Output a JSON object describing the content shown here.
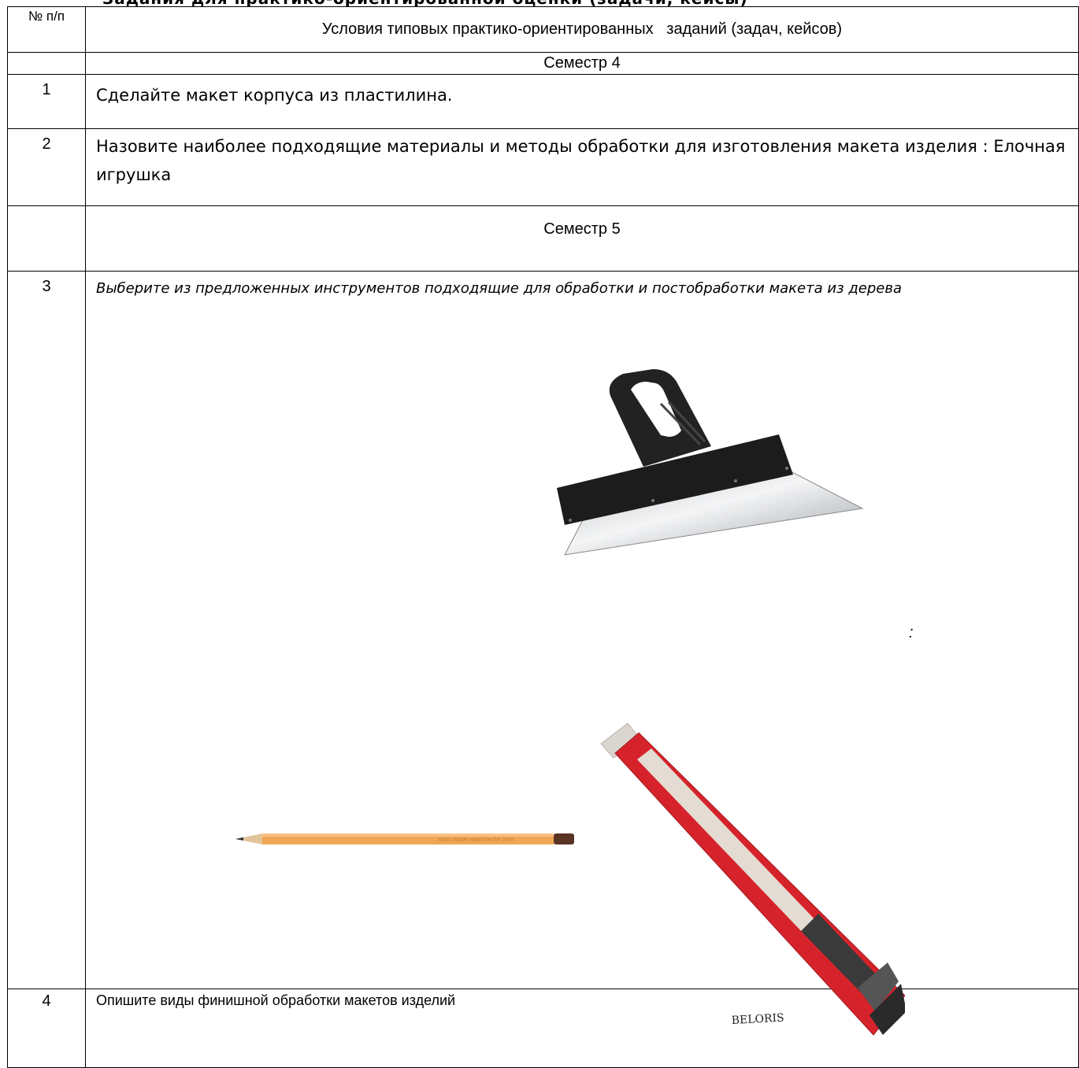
{
  "header": {
    "num_col": "№ п/п",
    "title": "Условия типовых практико-ориентированных   заданий (задач, кейсов)"
  },
  "rows": [
    {
      "type": "semester",
      "label": "Семестр 4"
    },
    {
      "type": "task",
      "num": "1",
      "text": "Сделайте макет корпуса из пластилина."
    },
    {
      "type": "task",
      "num": "2",
      "text": "Назовите наиболее подходящие материалы и методы обработки для изготовления макета изделия : Елочная игрушка"
    },
    {
      "type": "semester",
      "label": "Семестр 5"
    },
    {
      "type": "task",
      "num": "3",
      "text": "Выберите из предложенных инструментов подходящие для обработки и постобработки макета из дерева",
      "colon": ":",
      "images": [
        "spatula-image",
        "pencil-image",
        "utility-knife-image"
      ],
      "knife_brand": "BELORIS"
    },
    {
      "type": "task",
      "num": "4",
      "text": "Опишите виды финишной обработки макетов изделий"
    }
  ]
}
